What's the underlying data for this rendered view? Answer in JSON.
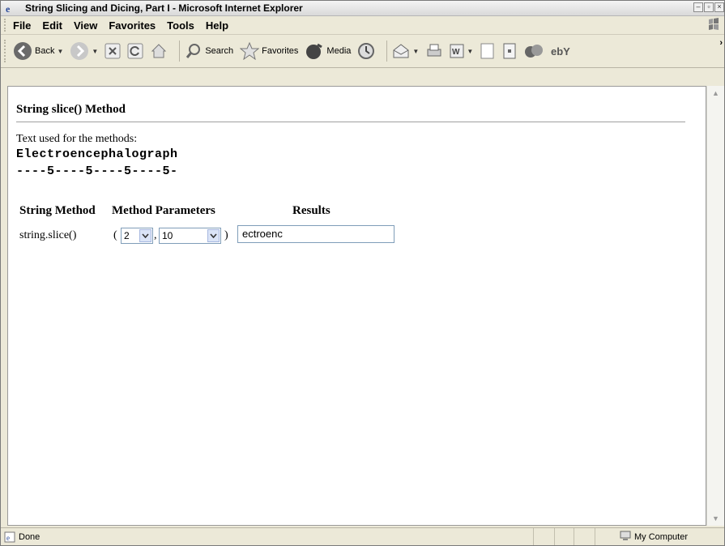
{
  "window": {
    "title": "String Slicing and Dicing, Part I - Microsoft Internet Explorer"
  },
  "menu": {
    "items": [
      "File",
      "Edit",
      "View",
      "Favorites",
      "Tools",
      "Help"
    ]
  },
  "toolbar": {
    "back_label": "Back",
    "search_label": "Search",
    "favorites_label": "Favorites",
    "media_label": "Media"
  },
  "page": {
    "title": "String slice() Method",
    "description": "Text used for the methods:",
    "sample_text": "Electroencephalograph",
    "ruler": "----5----5----5----5-",
    "table": {
      "headers": [
        "String Method",
        "Method Parameters",
        "Results"
      ],
      "row": {
        "method": "string.slice()",
        "open_paren": "(",
        "param1": "2",
        "comma": ",",
        "param2": "10",
        "close_paren": ")",
        "result": "ectroenc"
      }
    }
  },
  "status": {
    "text": "Done",
    "zone": "My Computer"
  }
}
